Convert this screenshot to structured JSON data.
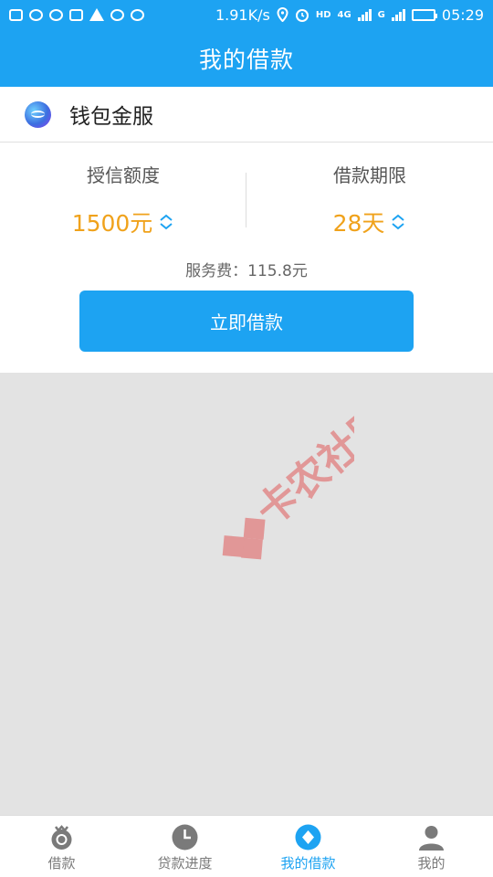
{
  "status_bar": {
    "network_speed": "1.91K/s",
    "network_4g": "4G",
    "network_g": "G",
    "time": "05:29",
    "battery_level": 1.0,
    "icons": [
      "message-icon",
      "qq-icon",
      "wechat-icon",
      "image-icon",
      "warning-icon",
      "chat-icon",
      "more-icon",
      "location-icon",
      "alarm-icon",
      "hd-icon",
      "signal-icon",
      "battery-icon"
    ]
  },
  "header": {
    "title": "我的借款"
  },
  "brand": {
    "name": "钱包金服"
  },
  "credit": {
    "label": "授信额度",
    "value": "1500元"
  },
  "term": {
    "label": "借款期限",
    "value": "28天"
  },
  "fee": {
    "label": "服务费：",
    "value": "115.8元"
  },
  "borrow_button": {
    "label": "立即借款"
  },
  "watermark": {
    "text": "卡农社区"
  },
  "tabs": [
    {
      "label": "借款",
      "icon": "loan-icon",
      "active": false
    },
    {
      "label": "贷款进度",
      "icon": "clock-icon",
      "active": false
    },
    {
      "label": "我的借款",
      "icon": "diamond-icon",
      "active": true
    },
    {
      "label": "我的",
      "icon": "person-icon",
      "active": false
    }
  ],
  "colors": {
    "primary": "#1da3f2",
    "accent": "#f0a21b",
    "watermark": "#e05a5a"
  }
}
